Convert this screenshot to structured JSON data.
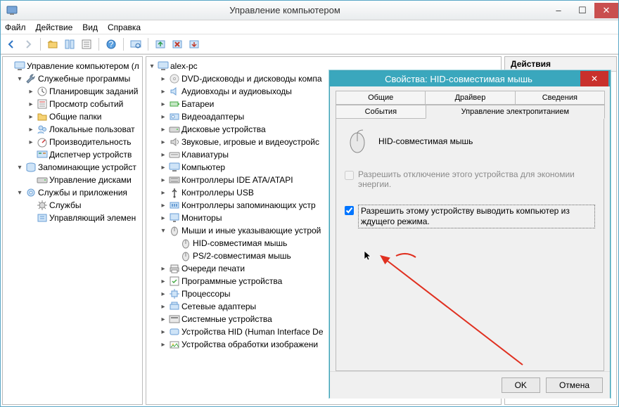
{
  "window": {
    "title": "Управление компьютером",
    "menu": {
      "file": "Файл",
      "action": "Действие",
      "view": "Вид",
      "help": "Справка"
    },
    "actions_header": "Действия"
  },
  "left_tree": [
    {
      "indent": 0,
      "exp": "",
      "icon": "computer",
      "label": "Управление компьютером (л"
    },
    {
      "indent": 1,
      "exp": "▾",
      "icon": "wrench",
      "label": "Служебные программы"
    },
    {
      "indent": 2,
      "exp": "▸",
      "icon": "clock",
      "label": "Планировщик заданий"
    },
    {
      "indent": 2,
      "exp": "▸",
      "icon": "eventlog",
      "label": "Просмотр событий"
    },
    {
      "indent": 2,
      "exp": "▸",
      "icon": "folder",
      "label": "Общие папки"
    },
    {
      "indent": 2,
      "exp": "▸",
      "icon": "users",
      "label": "Локальные пользоват"
    },
    {
      "indent": 2,
      "exp": "▸",
      "icon": "perf",
      "label": "Производительность"
    },
    {
      "indent": 2,
      "exp": "",
      "icon": "devmgr",
      "label": "Диспетчер устройств"
    },
    {
      "indent": 1,
      "exp": "▾",
      "icon": "storage",
      "label": "Запоминающие устройст"
    },
    {
      "indent": 2,
      "exp": "",
      "icon": "disk",
      "label": "Управление дисками"
    },
    {
      "indent": 1,
      "exp": "▾",
      "icon": "services",
      "label": "Службы и приложения"
    },
    {
      "indent": 2,
      "exp": "",
      "icon": "gear",
      "label": "Службы"
    },
    {
      "indent": 2,
      "exp": "",
      "icon": "wmi",
      "label": "Управляющий элемен"
    }
  ],
  "mid_tree": [
    {
      "indent": 0,
      "exp": "▾",
      "icon": "computer",
      "label": "alex-pc"
    },
    {
      "indent": 1,
      "exp": "▸",
      "icon": "dvd",
      "label": "DVD-дисководы и дисководы компа"
    },
    {
      "indent": 1,
      "exp": "▸",
      "icon": "audio",
      "label": "Аудиовходы и аудиовыходы"
    },
    {
      "indent": 1,
      "exp": "▸",
      "icon": "battery",
      "label": "Батареи"
    },
    {
      "indent": 1,
      "exp": "▸",
      "icon": "video",
      "label": "Видеоадаптеры"
    },
    {
      "indent": 1,
      "exp": "▸",
      "icon": "disk",
      "label": "Дисковые устройства"
    },
    {
      "indent": 1,
      "exp": "▸",
      "icon": "sound",
      "label": "Звуковые, игровые и видеоустройс"
    },
    {
      "indent": 1,
      "exp": "▸",
      "icon": "keyboard",
      "label": "Клавиатуры"
    },
    {
      "indent": 1,
      "exp": "▸",
      "icon": "computer",
      "label": "Компьютер"
    },
    {
      "indent": 1,
      "exp": "▸",
      "icon": "ide",
      "label": "Контроллеры IDE ATA/ATAPI"
    },
    {
      "indent": 1,
      "exp": "▸",
      "icon": "usb",
      "label": "Контроллеры USB"
    },
    {
      "indent": 1,
      "exp": "▸",
      "icon": "memctl",
      "label": "Контроллеры запоминающих устр"
    },
    {
      "indent": 1,
      "exp": "▸",
      "icon": "monitor",
      "label": "Мониторы"
    },
    {
      "indent": 1,
      "exp": "▾",
      "icon": "mouse",
      "label": "Мыши и иные указывающие устрой"
    },
    {
      "indent": 2,
      "exp": "",
      "icon": "mouse",
      "label": "HID-совместимая мышь"
    },
    {
      "indent": 2,
      "exp": "",
      "icon": "mouse",
      "label": "PS/2-совместимая мышь"
    },
    {
      "indent": 1,
      "exp": "▸",
      "icon": "printer",
      "label": "Очереди печати"
    },
    {
      "indent": 1,
      "exp": "▸",
      "icon": "swdev",
      "label": "Программные устройства"
    },
    {
      "indent": 1,
      "exp": "▸",
      "icon": "cpu",
      "label": "Процессоры"
    },
    {
      "indent": 1,
      "exp": "▸",
      "icon": "net",
      "label": "Сетевые адаптеры"
    },
    {
      "indent": 1,
      "exp": "▸",
      "icon": "system",
      "label": "Системные устройства"
    },
    {
      "indent": 1,
      "exp": "▸",
      "icon": "hid",
      "label": "Устройства HID (Human Interface De"
    },
    {
      "indent": 1,
      "exp": "▸",
      "icon": "imaging",
      "label": "Устройства обработки изображени"
    }
  ],
  "dialog": {
    "title": "Свойства: HID-совместимая мышь",
    "tabs_row1": {
      "general": "Общие",
      "driver": "Драйвер",
      "details": "Сведения"
    },
    "tabs_row2": {
      "events": "События",
      "power": "Управление электропитанием"
    },
    "device_name": "HID-совместимая мышь",
    "chk_allow_off": "Разрешить отключение этого устройства для экономии энергии.",
    "chk_wake": "Разрешить этому устройству выводить компьютер из ждущего режима.",
    "ok": "OK",
    "cancel": "Отмена"
  }
}
